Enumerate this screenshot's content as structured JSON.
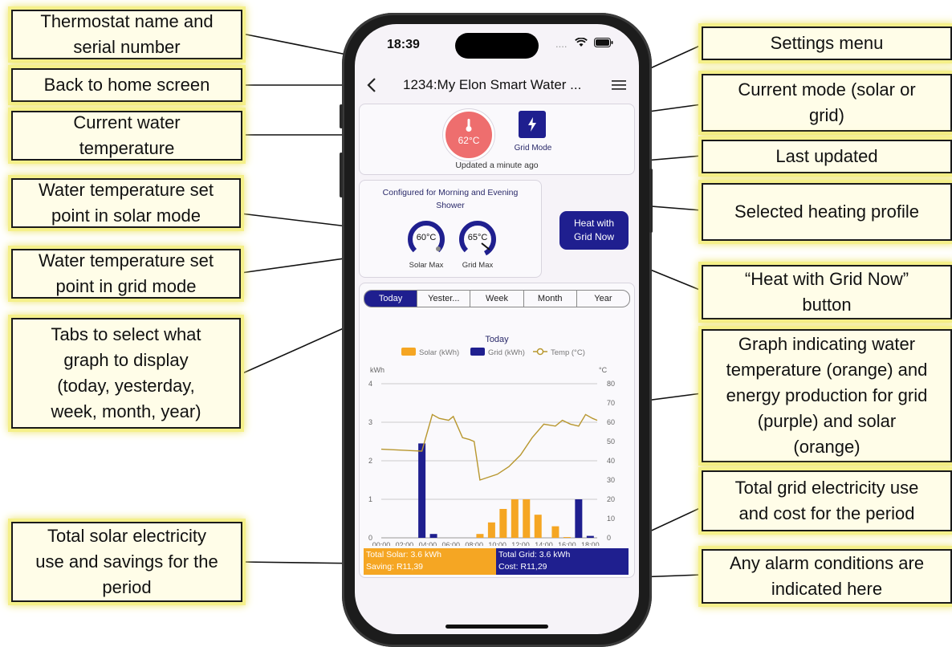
{
  "status_bar": {
    "time": "18:39",
    "signal": "....",
    "wifi": "wifi-icon",
    "battery": "battery-icon"
  },
  "nav": {
    "back_icon": "chevron-left-icon",
    "title": "1234:My Elon Smart Water ...",
    "menu_icon": "hamburger-menu-icon"
  },
  "status": {
    "temperature": "62°C",
    "mode_label": "Grid Mode",
    "mode_icon": "lightning-icon",
    "updated": "Updated a minute ago"
  },
  "profile": {
    "line1": "Configured for Morning and Evening",
    "line2": "Shower"
  },
  "gauges": [
    {
      "value": "60°C",
      "label": "Solar Max"
    },
    {
      "value": "65°C",
      "label": "Grid Max"
    }
  ],
  "heat_button": {
    "line1": "Heat with",
    "line2": "Grid Now"
  },
  "tabs": [
    "Today",
    "Yester...",
    "Week",
    "Month",
    "Year"
  ],
  "active_tab": 0,
  "totals": {
    "solar_line1": "Total Solar: 3.6 kWh",
    "solar_line2": "Saving: R11,39",
    "grid_line1": "Total Grid: 3.6 kWh",
    "grid_line2": "Cost: R11,29"
  },
  "colors": {
    "solar": "#f5a623",
    "grid": "#1f1f8f",
    "temp": "#b8972f",
    "temp_badge": "#ee6e6e"
  },
  "chart_data": {
    "type": "bar",
    "title": "Today",
    "legend": [
      "Solar (kWh)",
      "Grid (kWh)",
      "Temp (°C)"
    ],
    "legend_placement": "top",
    "y_left_label": "kWh",
    "y_right_label": "°C",
    "y_left_ticks": [
      "0",
      "1",
      "2",
      "3",
      "4"
    ],
    "y_right_ticks": [
      "0",
      "10",
      "20",
      "30",
      "40",
      "50",
      "60",
      "70",
      "80"
    ],
    "x_ticks": [
      "00:00",
      "02:00",
      "04:00",
      "06:00",
      "08:00",
      "10:00",
      "12:00",
      "14:00",
      "16:00",
      "18:00"
    ],
    "ylim_left": [
      0,
      4
    ],
    "ylim_right": [
      0,
      80
    ],
    "grid": true,
    "series": [
      {
        "name": "Solar (kWh)",
        "kind": "bar",
        "points": [
          [
            8.5,
            0.1
          ],
          [
            9.5,
            0.4
          ],
          [
            10.5,
            0.75
          ],
          [
            11.5,
            1.0
          ],
          [
            12.5,
            1.0
          ],
          [
            13.5,
            0.6
          ],
          [
            15.0,
            0.3
          ],
          [
            16.0,
            0.02
          ]
        ]
      },
      {
        "name": "Grid (kWh)",
        "kind": "bar",
        "points": [
          [
            3.5,
            2.45
          ],
          [
            4.5,
            0.1
          ],
          [
            17.0,
            1.0
          ],
          [
            18.0,
            0.05
          ]
        ]
      },
      {
        "name": "Temp (°C)",
        "kind": "line",
        "points": [
          [
            0,
            46
          ],
          [
            3.5,
            45
          ],
          [
            4.4,
            64
          ],
          [
            5.0,
            62
          ],
          [
            5.8,
            61
          ],
          [
            6.2,
            63
          ],
          [
            7.0,
            52
          ],
          [
            7.6,
            51
          ],
          [
            8.0,
            50
          ],
          [
            8.5,
            30
          ],
          [
            10.0,
            33
          ],
          [
            11.0,
            37
          ],
          [
            12.0,
            43
          ],
          [
            13.0,
            52
          ],
          [
            14.0,
            59
          ],
          [
            15.0,
            58
          ],
          [
            15.6,
            61
          ],
          [
            16.3,
            59
          ],
          [
            17.0,
            58
          ],
          [
            17.6,
            64
          ],
          [
            18.2,
            62
          ],
          [
            18.6,
            61
          ]
        ]
      }
    ]
  },
  "callouts": {
    "name": "Thermostat name and\nserial number",
    "back": "Back to home screen",
    "water_temp": "Current water\ntemperature",
    "solar_setpoint": "Water temperature set\npoint in solar mode",
    "grid_setpoint": "Water temperature set\npoint in grid mode",
    "tabs": "Tabs to select what\ngraph to display\n(today, yesterday,\nweek, month, year)",
    "solar_total": "Total solar electricity\nuse and savings for the\nperiod",
    "settings": "Settings menu",
    "mode": "Current mode (solar or\ngrid)",
    "updated": "Last updated",
    "profile": "Selected heating profile",
    "heat_now": "“Heat with Grid Now”\nbutton",
    "graph": "Graph indicating water\ntemperature (orange) and\nenergy production for grid\n(purple) and solar\n(orange)",
    "grid_total": "Total grid electricity use\nand cost for the period",
    "alarms": "Any alarm conditions are\nindicated here"
  }
}
